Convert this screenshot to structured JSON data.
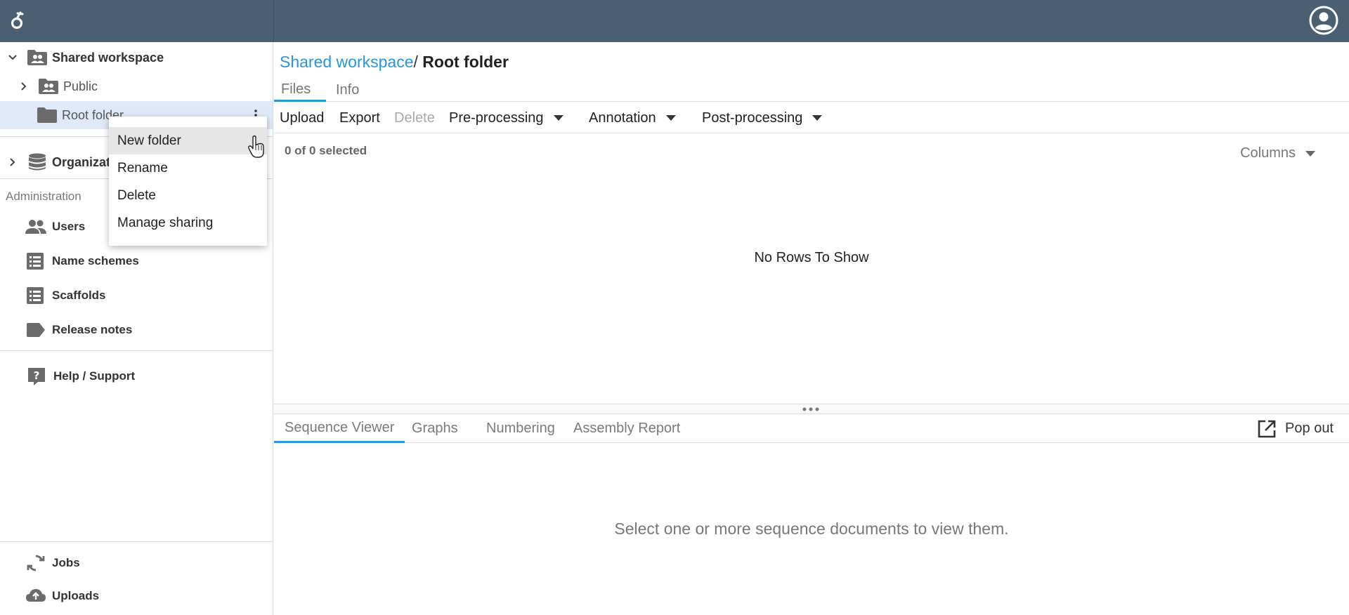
{
  "sidebar": {
    "tree": {
      "shared_workspace": "Shared workspace",
      "public": "Public",
      "root_folder": "Root folder",
      "organization": "Organizat"
    },
    "administration_label": "Administration",
    "admin_items": [
      "Users",
      "Name schemes",
      "Scaffolds",
      "Release notes"
    ],
    "help": "Help / Support",
    "footer_items": [
      "Jobs",
      "Uploads"
    ]
  },
  "context_menu": {
    "items": [
      "New folder",
      "Rename",
      "Delete",
      "Manage sharing"
    ],
    "hovered": "New folder"
  },
  "main": {
    "breadcrumb": {
      "link": "Shared workspace",
      "separator": "/",
      "current": "Root folder"
    },
    "tabs": [
      "Files",
      "Info"
    ],
    "active_tab": "Files",
    "toolbar": {
      "upload": "Upload",
      "export": "Export",
      "delete": "Delete",
      "preprocessing": "Pre-processing",
      "annotation": "Annotation",
      "postprocessing": "Post-processing"
    },
    "selection_status": "0 of 0 selected",
    "columns_label": "Columns",
    "empty_grid": "No Rows To Show",
    "bottom_tabs": [
      "Sequence Viewer",
      "Graphs",
      "Numbering",
      "Assembly Report"
    ],
    "active_bottom_tab": "Sequence Viewer",
    "popout": "Pop out",
    "viewer_empty": "Select one or more sequence documents to view them."
  },
  "colors": {
    "topbar": "#4b5f72",
    "accent": "#2a96d8",
    "selected_row": "#dfe9f7"
  },
  "icons": [
    "logo-icon",
    "account-icon",
    "chevron-down-icon",
    "chevron-right-icon",
    "group-folder-icon",
    "folder-icon",
    "database-icon",
    "users-icon",
    "list-icon",
    "label-icon",
    "help-icon",
    "refresh-icon",
    "cloud-upload-icon",
    "popout-icon",
    "caret-down-icon",
    "kebab-icon"
  ]
}
